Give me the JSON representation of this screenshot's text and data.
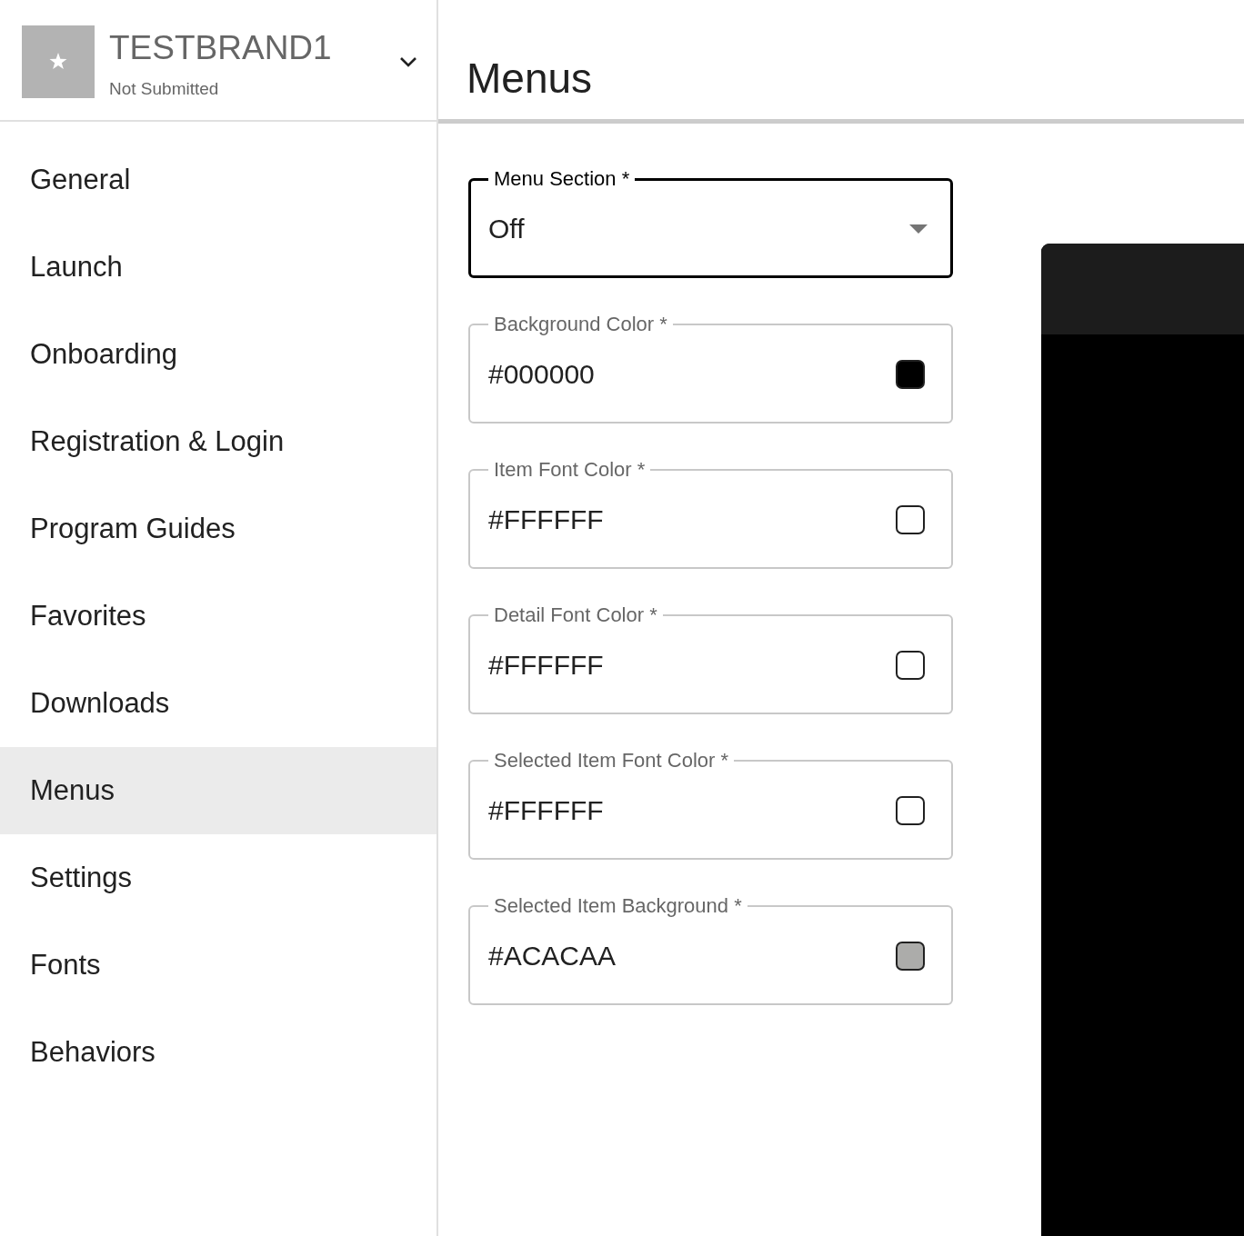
{
  "brand": {
    "name": "TESTBRAND1",
    "status": "Not Submitted"
  },
  "nav": [
    {
      "label": "General",
      "selected": false
    },
    {
      "label": "Launch",
      "selected": false
    },
    {
      "label": "Onboarding",
      "selected": false
    },
    {
      "label": "Registration & Login",
      "selected": false
    },
    {
      "label": "Program Guides",
      "selected": false
    },
    {
      "label": "Favorites",
      "selected": false
    },
    {
      "label": "Downloads",
      "selected": false
    },
    {
      "label": "Menus",
      "selected": true
    },
    {
      "label": "Settings",
      "selected": false
    },
    {
      "label": "Fonts",
      "selected": false
    },
    {
      "label": "Behaviors",
      "selected": false
    }
  ],
  "page": {
    "title": "Menus"
  },
  "fields": [
    {
      "kind": "select",
      "label": "Menu Section *",
      "value": "Off",
      "focused": true
    },
    {
      "kind": "color",
      "label": "Background Color *",
      "value": "#000000",
      "color": "#000000",
      "focused": false
    },
    {
      "kind": "color",
      "label": "Item Font Color *",
      "value": "#FFFFFF",
      "color": "#ffffff",
      "focused": false
    },
    {
      "kind": "color",
      "label": "Detail Font Color *",
      "value": "#FFFFFF",
      "color": "#ffffff",
      "focused": false
    },
    {
      "kind": "color",
      "label": "Selected Item Font Color *",
      "value": "#FFFFFF",
      "color": "#ffffff",
      "focused": false
    },
    {
      "kind": "color",
      "label": "Selected Item Background *",
      "value": "#ACACAA",
      "color": "#acacaa",
      "focused": false
    }
  ]
}
